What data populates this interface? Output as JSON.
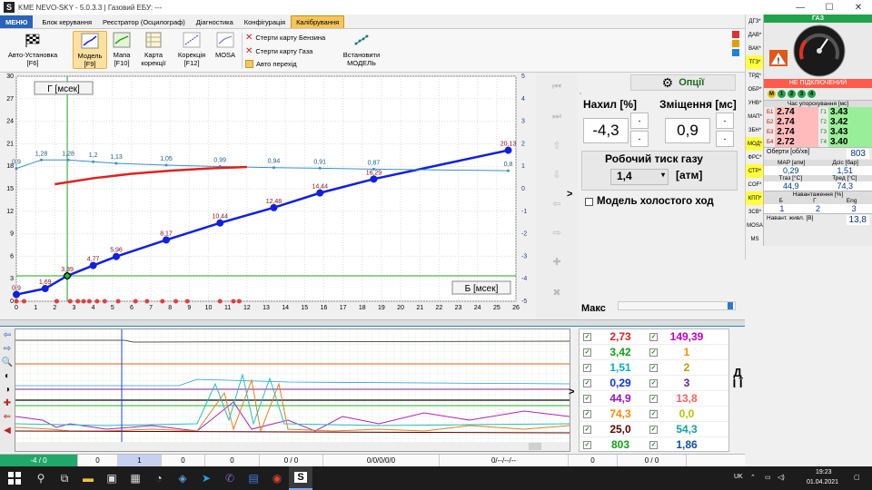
{
  "window": {
    "title": "KME NEVO-SKY - 5.0.3.3  |  Газовий ЕБУ: ---"
  },
  "menu": {
    "file": "МЕНЮ",
    "tabs": [
      "Блок керування",
      "Реєстратор (Осцилограф)",
      "Діагностика",
      "Конфігурація",
      "Калібрування"
    ]
  },
  "ribbon": {
    "auto_setup": "Авто-Установка\n[F6]",
    "model": "Модель\n[F9]",
    "map": "Мапа\n[F10]",
    "corr_map": "Карта\nкорекції",
    "correction": "Корекція\n[F12]",
    "mosa": "MOSA",
    "erase_petrol": "Стерти карту Бензина",
    "erase_gas": "Стерти карту Газа",
    "auto_switch": "Авто перехід",
    "set_model": "Встановити\nМОДЕЛЬ"
  },
  "side_tabs": [
    "ДГЗ*",
    "ДАВ*",
    "ВАК*",
    "ТГЗ*",
    "ТРД*",
    "ОБР*",
    "УНВ*",
    "МАП*",
    "ЗБН*",
    "МОД*",
    "ФРС*",
    "СТР*",
    "COF*",
    "КПП*",
    "ЗСВ*",
    "MOSA",
    "MS"
  ],
  "panel": {
    "gas_header": "ГАЗ",
    "not_connected": "НЕ ПІДКЛЮЧЕНИЙ",
    "injectors": [
      "1",
      "2",
      "3",
      "4"
    ],
    "inj_header": "Час упорскування [мс]",
    "inj_rows": [
      {
        "b": "Б1",
        "bv": "2.74",
        "g": "Г1",
        "gv": "3.43"
      },
      {
        "b": "Б2",
        "bv": "2.74",
        "g": "Г2",
        "gv": "3.42"
      },
      {
        "b": "Б3",
        "bv": "2.74",
        "g": "Г3",
        "gv": "3.43"
      },
      {
        "b": "Б4",
        "bv": "2.72",
        "g": "Г4",
        "gv": "3.40"
      }
    ],
    "rpm_label": "Оберти [об/хв]",
    "rpm": "803",
    "map_label": "MAP [атм]",
    "ps_label": "Дсіс [бар]",
    "map": "0,29",
    "ps": "1,51",
    "tgas_label": "Тгаз [°C]",
    "tred_label": "Тред [°C]",
    "tgas": "44,9",
    "tred": "74,3",
    "load_label": "Навантаження [%]",
    "load_cols": [
      "Б",
      "Г",
      "Eng"
    ],
    "load_vals": [
      "1",
      "2",
      "3"
    ],
    "fuel_label": "Навант. живл. [В]",
    "fuel": "13,8"
  },
  "chart_data": {
    "type": "line",
    "title": "",
    "xlabel": "Б [мсек]",
    "ylabel": "Г [мсек]",
    "xlim": [
      0,
      26
    ],
    "ylim": [
      0,
      30
    ],
    "y2lim": [
      -5,
      5
    ],
    "x_ticks": [
      0,
      1,
      2,
      3,
      4,
      5,
      6,
      7,
      8,
      9,
      10,
      11,
      12,
      13,
      14,
      15,
      16,
      17,
      18,
      19,
      20,
      21,
      22,
      23,
      24,
      25,
      26
    ],
    "y_ticks": [
      0,
      3,
      6,
      9,
      12,
      15,
      18,
      21,
      24,
      27,
      30
    ],
    "y2_ticks": [
      -5,
      -4,
      -3,
      -2,
      -1,
      0,
      1,
      2,
      3,
      4,
      5
    ],
    "series": [
      {
        "color": "#1020e0",
        "x": [
          0,
          1.5,
          2.65,
          4,
          5.2,
          7.8,
          10.6,
          13.4,
          15.8,
          18.6,
          25.6
        ],
        "y": [
          0.9,
          1.69,
          3.39,
          4.77,
          5.96,
          8.17,
          10.44,
          12.48,
          14.44,
          16.29,
          20.13
        ],
        "labels": [
          "0,9",
          "1,69",
          "3,39",
          "4,77",
          "5,96",
          "8,17",
          "10,44",
          "12,48",
          "14,44",
          "16,29",
          "20,13"
        ]
      },
      {
        "color": "#3b8fc4",
        "x": [
          0,
          1.3,
          2.7,
          4,
          5.2,
          7.8,
          10.6,
          13.4,
          15.8,
          18.6,
          25.6
        ],
        "y": [
          0.9,
          1.28,
          1.28,
          1.2,
          1.13,
          1.05,
          0.99,
          0.94,
          0.91,
          0.87,
          0.8
        ],
        "labels": [
          "0,9",
          "1,28",
          "1,28",
          "1,2",
          "1,13",
          "1,05",
          "0,99",
          "0,94",
          "0,91",
          "0,87",
          "0,8"
        ],
        "axis": "right"
      },
      {
        "color": "#e02020",
        "x": [
          2,
          4,
          6,
          8,
          10,
          12
        ],
        "y": [
          15.6,
          16.4,
          17,
          17.4,
          17.7,
          17.9
        ]
      }
    ],
    "marker_line": {
      "x": 2.65,
      "y": 3.39
    }
  },
  "options": {
    "title": "Опції",
    "slope_label": "Нахил [%]",
    "offset_label": "Зміщення [мс]",
    "slope": "-4,3",
    "offset": "0,9",
    "pressure_label": "Робочий тиск газу",
    "pressure": "1,4",
    "pressure_unit": "[атм]",
    "idle_label": "Модель холостого ход",
    "max_label": "Макс"
  },
  "values_table": [
    {
      "a": "2,73",
      "ac": "#e02020",
      "b": "149,39",
      "bc": "#c000c0"
    },
    {
      "a": "3,42",
      "ac": "#10a010",
      "b": "1",
      "bc": "#ff8800"
    },
    {
      "a": "1,51",
      "ac": "#00b0c0",
      "b": "2",
      "bc": "#b0a000"
    },
    {
      "a": "0,29",
      "ac": "#1030e0",
      "b": "3",
      "bc": "#6020a0"
    },
    {
      "a": "44,9",
      "ac": "#a010c0",
      "b": "13,8",
      "bc": "#ff6060"
    },
    {
      "a": "74,3",
      "ac": "#ff8800",
      "b": "0,0",
      "bc": "#c0c000"
    },
    {
      "a": "25,0",
      "ac": "#600000",
      "b": "54,3",
      "bc": "#10a0a0"
    },
    {
      "a": "803",
      "ac": "#10a010",
      "b": "1,86",
      "bc": "#1050a0"
    }
  ],
  "dii": "Д І Ї",
  "statusbar": [
    "-4 / 0",
    "0",
    "1",
    "0",
    "0",
    "0 / 0",
    "0/0/0/0/0",
    "0/--/--/--",
    "0",
    "0 / 0"
  ],
  "clock": {
    "time": "19:23",
    "date": "01.04.2021",
    "lang": "UK"
  }
}
